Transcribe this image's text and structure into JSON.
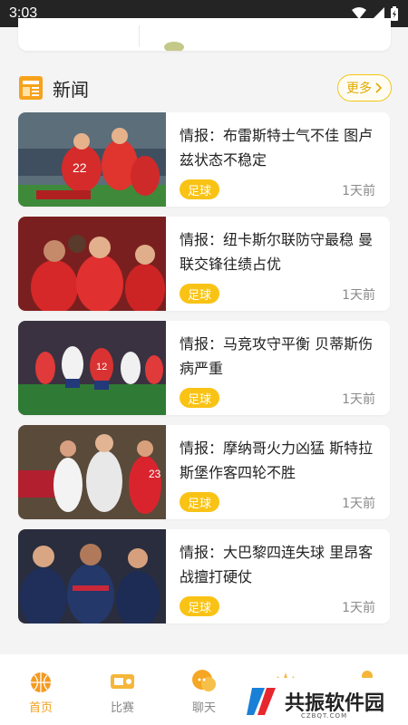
{
  "status_bar": {
    "time": "3:03"
  },
  "section": {
    "title": "新闻",
    "more_label": "更多"
  },
  "news": [
    {
      "title": "情报：布雷斯特士气不佳 图卢兹状态不稳定",
      "tag": "足球",
      "time": "1天前"
    },
    {
      "title": "情报：纽卡斯尔联防守最稳 曼联交锋往绩占优",
      "tag": "足球",
      "time": "1天前"
    },
    {
      "title": "情报：马竞攻守平衡 贝蒂斯伤病严重",
      "tag": "足球",
      "time": "1天前"
    },
    {
      "title": "情报：摩纳哥火力凶猛 斯特拉斯堡作客四轮不胜",
      "tag": "足球",
      "time": "1天前"
    },
    {
      "title": "情报：大巴黎四连失球 里昂客战擅打硬仗",
      "tag": "足球",
      "time": "1天前"
    }
  ],
  "bottom_nav": [
    {
      "label": "首页",
      "icon": "home-basketball-icon"
    },
    {
      "label": "比赛",
      "icon": "ticket-icon"
    },
    {
      "label": "聊天",
      "icon": "chat-icon"
    },
    {
      "label": "",
      "icon": "crown-icon"
    },
    {
      "label": "",
      "icon": "profile-icon"
    }
  ],
  "watermark": {
    "text": "共振软件园",
    "url": "CZBQT.COM"
  },
  "colors": {
    "accent": "#f9c316",
    "tag_bg": "#f9c316",
    "active_nav": "#f0a020"
  }
}
